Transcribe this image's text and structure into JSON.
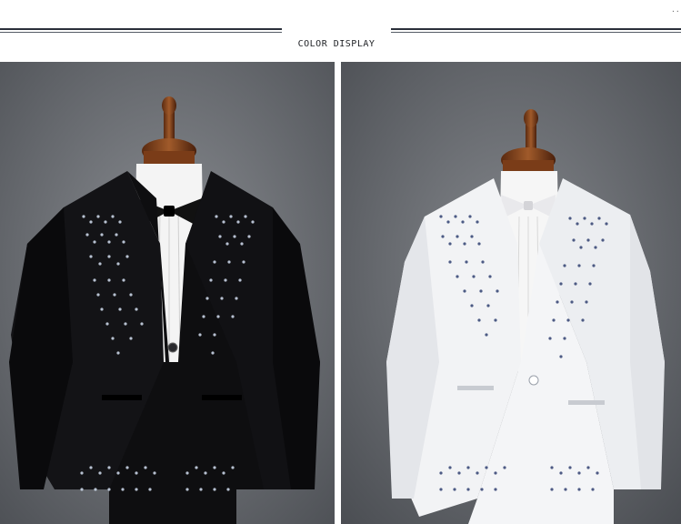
{
  "header": {
    "title": "COLOR DISPLAY",
    "corner_mark": "..."
  },
  "photos": [
    {
      "name": "black-suit",
      "jacket": "#0e0e10",
      "accent": "#c9d4e6",
      "background": "#6f7277"
    },
    {
      "name": "white-suit",
      "jacket": "#f2f3f5",
      "accent": "#3b4a78",
      "background": "#6a6d72"
    }
  ]
}
